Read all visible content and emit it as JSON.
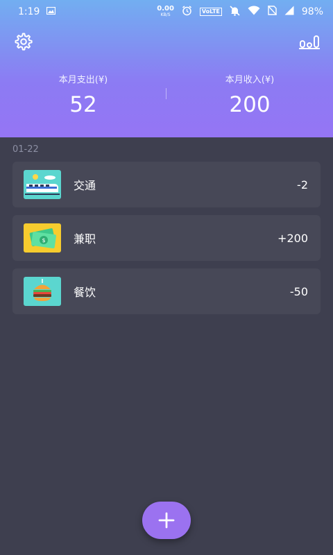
{
  "status_bar": {
    "time": "1:19",
    "net_speed_value": "0.00",
    "net_speed_unit": "KB/S",
    "volte_label": "VoLTE",
    "battery": "98%"
  },
  "summary": {
    "expense_label": "本月支出(¥)",
    "expense_value": "52",
    "income_label": "本月收入(¥)",
    "income_value": "200"
  },
  "date_group": "01-22",
  "records": [
    {
      "icon": "train-icon",
      "category": "交通",
      "amount": "-2"
    },
    {
      "icon": "cash-icon",
      "category": "兼职",
      "amount": "+200"
    },
    {
      "icon": "burger-icon",
      "category": "餐饮",
      "amount": "-50"
    }
  ],
  "colors": {
    "header_gradient_top": "#72aef1",
    "header_gradient_bottom": "#9575f4",
    "background": "#3e3f4f",
    "card": "#474857",
    "fab": "#9b72f0"
  },
  "icons": {
    "settings": "gear-icon",
    "chart": "chart-icon",
    "add": "plus-icon"
  }
}
